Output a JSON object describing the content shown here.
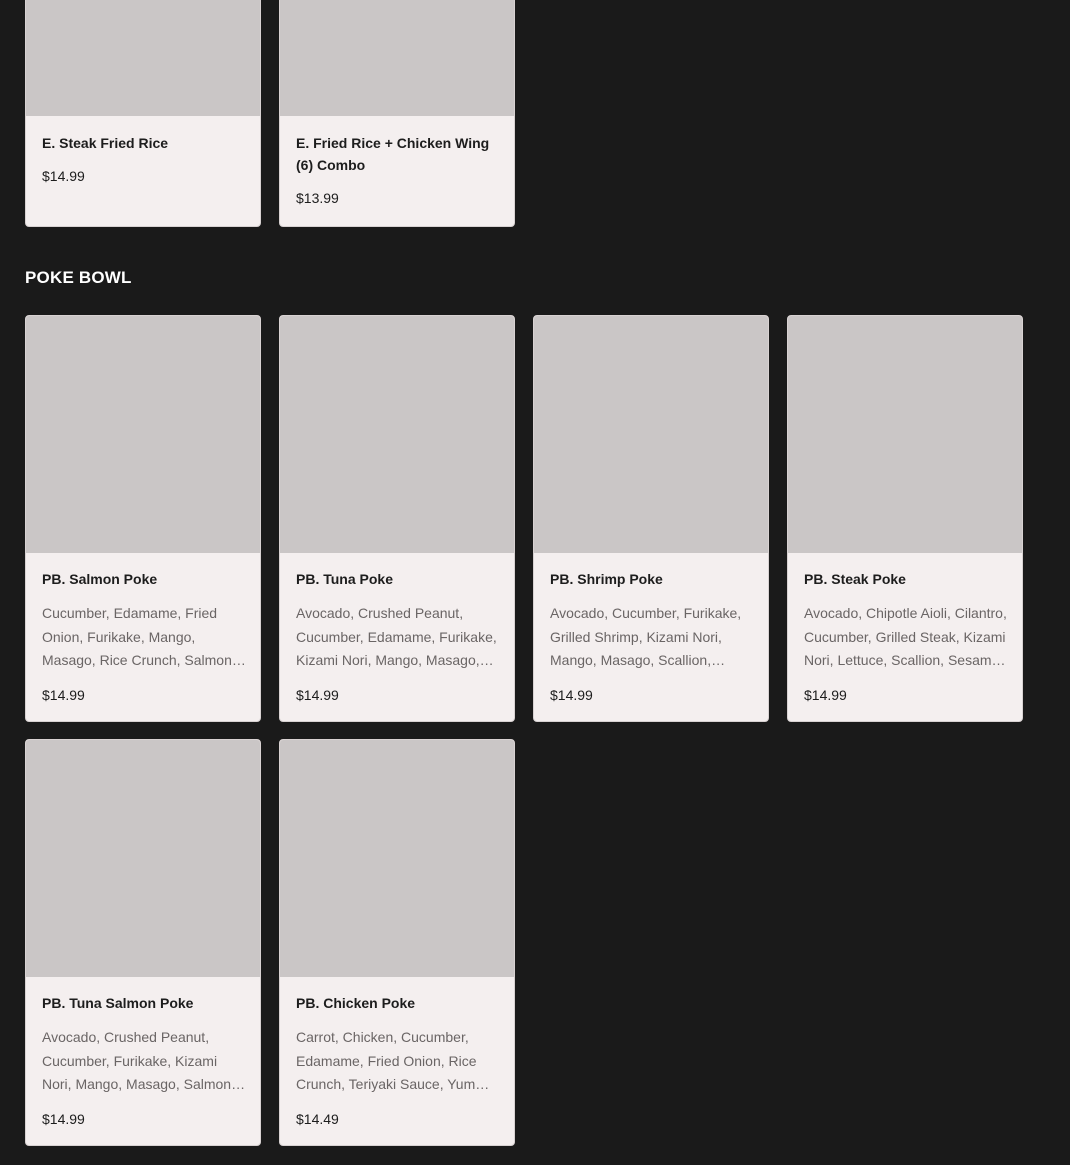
{
  "sections": {
    "previous": {
      "items": [
        {
          "name": "E. Steak Fried Rice",
          "price": "$14.99"
        },
        {
          "name": "E. Fried Rice + Chicken Wing (6) Combo",
          "price": "$13.99"
        }
      ]
    },
    "poke_bowl": {
      "title": "POKE BOWL",
      "items": [
        {
          "name": "PB. Salmon Poke",
          "description": "Cucumber, Edamame, Fried Onion, Furikake, Mango, Masago, Rice Crunch, Salmon, Scallion, Seaweed Salad, Sesame Seeds, Yum Yum Sauce",
          "price": "$14.99"
        },
        {
          "name": "PB. Tuna Poke",
          "description": "Avocado, Crushed Peanut, Cucumber, Edamame, Furikake, Kizami Nori, Mango, Masago, Scallion, Seaweed Salad, Tuna, Spicy Mayo",
          "price": "$14.99"
        },
        {
          "name": "PB. Shrimp Poke",
          "description": "Avocado, Cucumber, Furikake, Grilled Shrimp, Kizami Nori, Mango, Masago, Scallion, Sesame Seeds, Yum Yum Sauce",
          "price": "$14.99"
        },
        {
          "name": "PB. Steak Poke",
          "description": "Avocado, Chipotle Aioli, Cilantro, Cucumber, Grilled Steak, Kizami Nori, Lettuce, Scallion, Sesame Seeds, Teriyaki Sauce",
          "price": "$14.99"
        },
        {
          "name": "PB. Tuna Salmon Poke",
          "description": "Avocado, Crushed Peanut, Cucumber, Furikake, Kizami Nori, Mango, Masago, Salmon, Scallion, Tuna, Spicy Mayo",
          "price": "$14.99"
        },
        {
          "name": "PB. Chicken Poke",
          "description": "Carrot, Chicken, Cucumber, Edamame, Fried Onion, Rice Crunch, Teriyaki Sauce, Yum Yum Sauce, Scallion, Sesame Seeds",
          "price": "$14.49"
        }
      ]
    }
  }
}
